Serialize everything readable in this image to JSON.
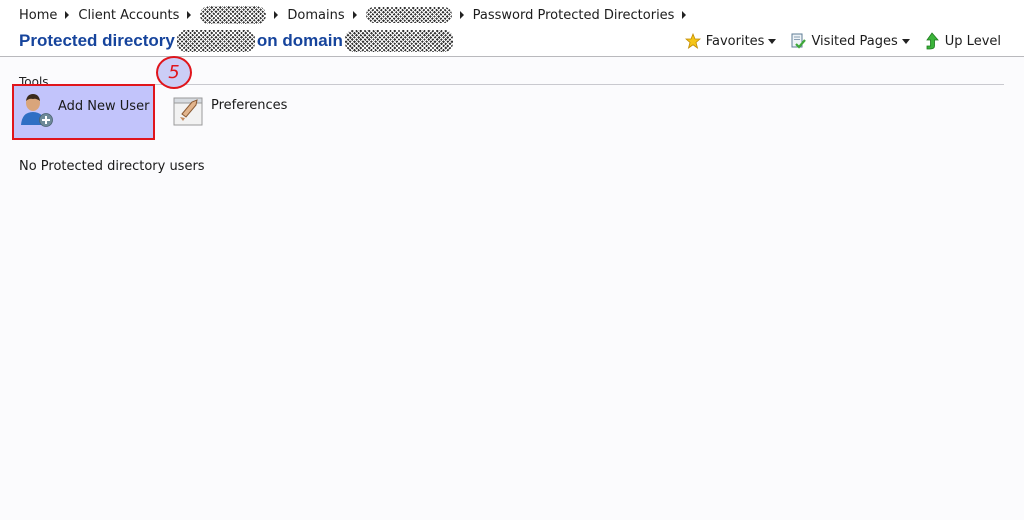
{
  "breadcrumb": {
    "items": [
      "Home",
      "Client Accounts",
      "Domains",
      "Password Protected Directories"
    ]
  },
  "header": {
    "title_prefix": "Protected directory",
    "title_middle": "on domain"
  },
  "actions": {
    "favorites": "Favorites",
    "visited_pages": "Visited Pages",
    "up_level": "Up Level"
  },
  "tools": {
    "heading": "Tools",
    "add_user": "Add New User",
    "preferences": "Preferences"
  },
  "annotation": {
    "step": "5"
  },
  "content": {
    "empty_message": "No Protected directory users"
  },
  "colors": {
    "title": "#16449c",
    "highlight_fill": "#c2c4fb",
    "highlight_border": "#e0151c"
  },
  "icons": [
    "triangle-right-icon",
    "star-icon",
    "visited-pages-icon",
    "up-arrow-icon",
    "user-add-icon",
    "preferences-icon"
  ]
}
